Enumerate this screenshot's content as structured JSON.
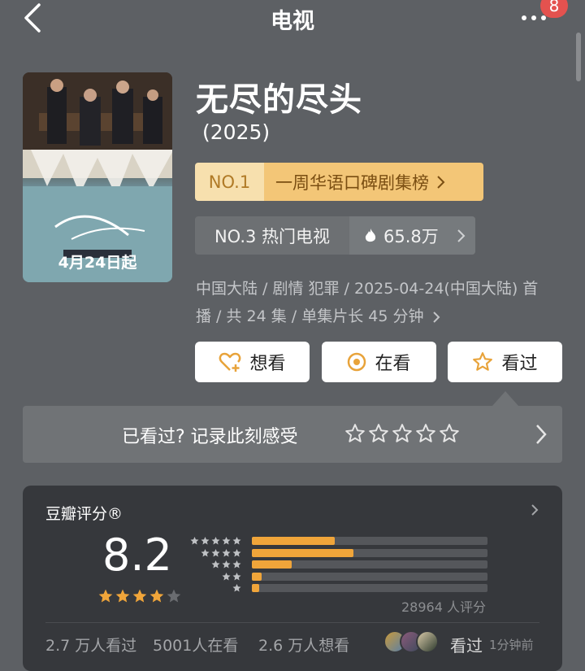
{
  "nav": {
    "title": "电视",
    "badge_count": "8",
    "icons": [
      "back-chevron-icon",
      "more-dots-icon"
    ]
  },
  "show": {
    "title": "无尽的尽头",
    "year": "(2025)",
    "poster_date": "4月24日起"
  },
  "ranks": {
    "primary": {
      "no": "NO.1",
      "label": "一周华语口碑剧集榜"
    },
    "secondary": {
      "label": "NO.3 热门电视",
      "heat": "65.8万"
    }
  },
  "meta": {
    "line1": "中国大陆 / 剧情 犯罪 / 2025-04-24(中国大陆) 首",
    "line2": "播 / 共 24 集 / 单集片长 45 分钟"
  },
  "actions": [
    {
      "label": "想看",
      "icon": "heart-plus-icon"
    },
    {
      "label": "在看",
      "icon": "circle-dot-icon"
    },
    {
      "label": "看过",
      "icon": "star-outline-icon"
    }
  ],
  "record": {
    "text": "已看过? 记录此刻感受",
    "star_count": 5
  },
  "rating": {
    "title": "豆瓣评分®",
    "score": "8.2",
    "stars": 4,
    "distribution": [
      0.35,
      0.43,
      0.17,
      0.04,
      0.03
    ],
    "count": "28964 人评分"
  },
  "stats": {
    "seen": "2.7 万人看过",
    "watching": "5001人在看",
    "wish": "2.6 万人想看",
    "recent_label": "看过",
    "recent_time": "1分钟前"
  },
  "colors": {
    "background": "#5d6064",
    "accent_orange": "#f0a53a",
    "gold_label": "#f3c677",
    "card": "#36383c",
    "badge_red": "#e4524f"
  }
}
